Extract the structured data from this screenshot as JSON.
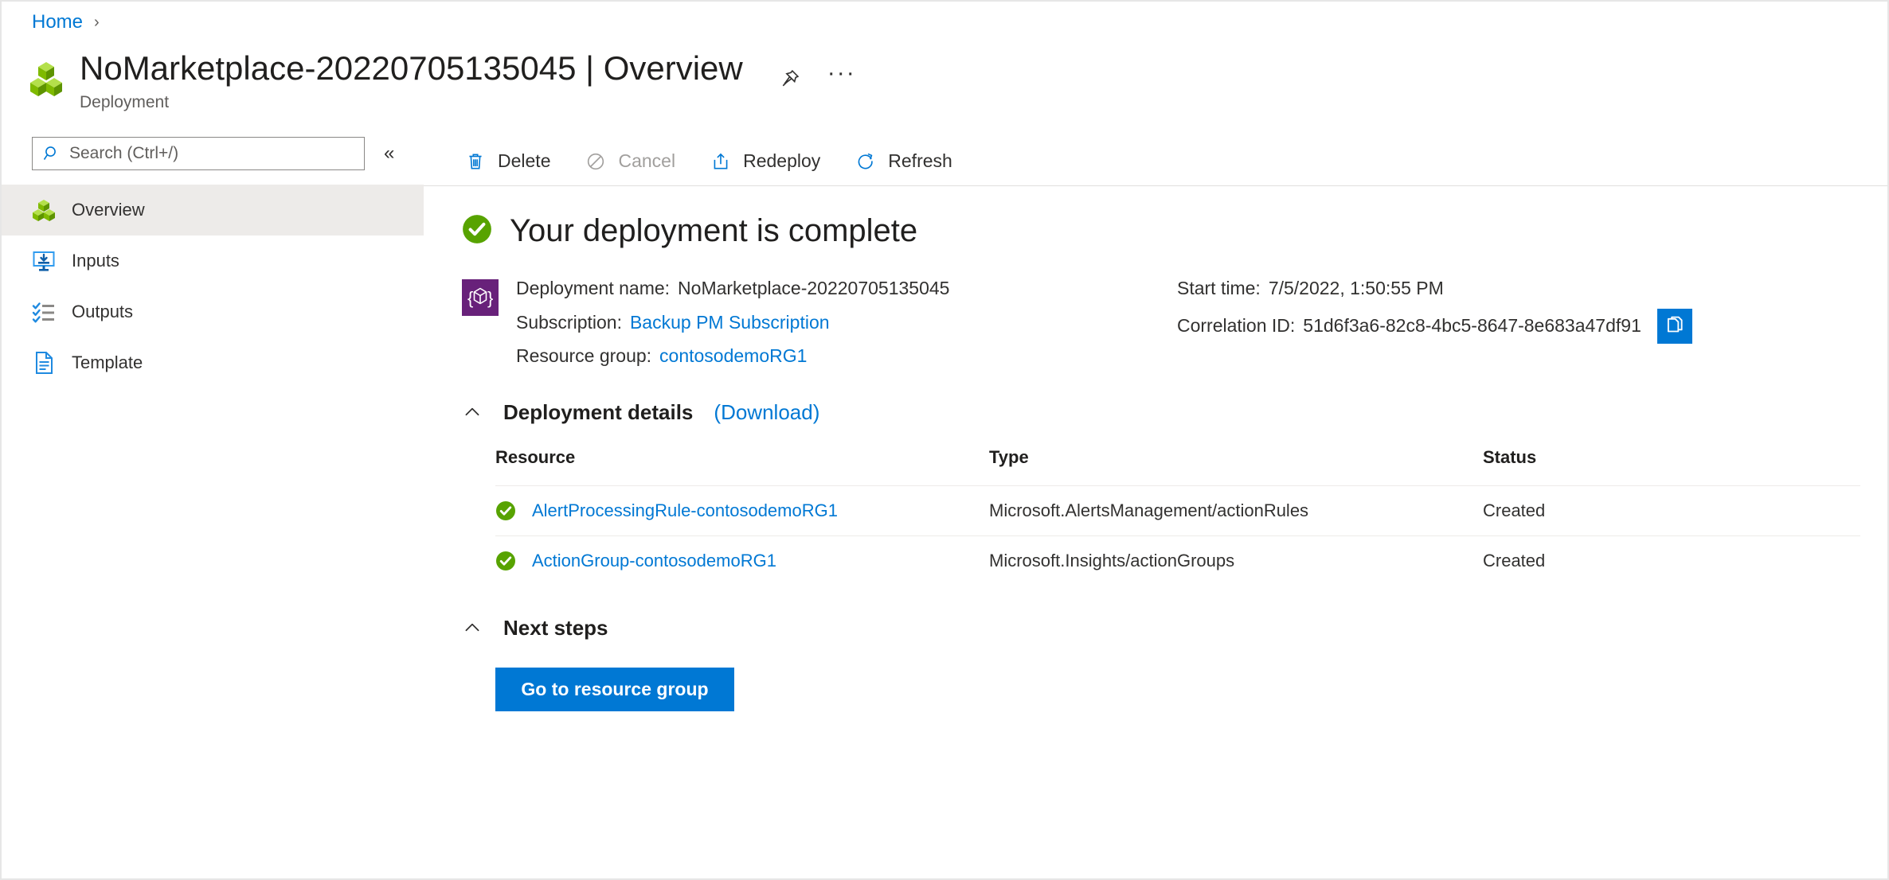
{
  "breadcrumb": {
    "home_label": "Home",
    "separator": "›"
  },
  "header": {
    "title": "NoMarketplace-20220705135045 | Overview",
    "subtitle": "Deployment",
    "icon": "resource-group-cubes-icon",
    "pin_icon": "pin-icon",
    "more_icon": "ellipsis-icon",
    "more_label": "···"
  },
  "sidebar": {
    "search": {
      "placeholder": "Search (Ctrl+/)",
      "value": "",
      "icon": "search-icon"
    },
    "collapse_label": "«",
    "items": [
      {
        "label": "Overview",
        "icon": "cubes-icon",
        "selected": true
      },
      {
        "label": "Inputs",
        "icon": "monitor-download-icon",
        "selected": false
      },
      {
        "label": "Outputs",
        "icon": "checklist-icon",
        "selected": false
      },
      {
        "label": "Template",
        "icon": "document-icon",
        "selected": false
      }
    ]
  },
  "toolbar": {
    "buttons": [
      {
        "label": "Delete",
        "icon": "trash-icon",
        "disabled": false
      },
      {
        "label": "Cancel",
        "icon": "no-entry-icon",
        "disabled": true
      },
      {
        "label": "Redeploy",
        "icon": "upload-box-icon",
        "disabled": false
      },
      {
        "label": "Refresh",
        "icon": "refresh-icon",
        "disabled": false
      }
    ]
  },
  "main": {
    "status_heading": "Your deployment is complete",
    "status_icon": "green-check-circle-icon",
    "deployment_icon": "arm-template-icon",
    "info": {
      "deployment_name_label": "Deployment name:",
      "deployment_name_value": "NoMarketplace-20220705135045",
      "subscription_label": "Subscription:",
      "subscription_value": "Backup PM Subscription",
      "resource_group_label": "Resource group:",
      "resource_group_value": "contosodemoRG1",
      "start_time_label": "Start time:",
      "start_time_value": "7/5/2022, 1:50:55 PM",
      "correlation_id_label": "Correlation ID:",
      "correlation_id_value": "51d6f3a6-82c8-4bc5-8647-8e683a47df91",
      "copy_icon": "copy-to-clipboard-icon"
    },
    "deployment_details": {
      "title": "Deployment details",
      "download_label": "(Download)",
      "chevron_icon": "chevron-up-icon",
      "columns": [
        "Resource",
        "Type",
        "Status"
      ],
      "rows": [
        {
          "status_icon": "green-check-icon",
          "resource": "AlertProcessingRule-contosodemoRG1",
          "type": "Microsoft.AlertsManagement/actionRules",
          "status": "Created"
        },
        {
          "status_icon": "green-check-icon",
          "resource": "ActionGroup-contosodemoRG1",
          "type": "Microsoft.Insights/actionGroups",
          "status": "Created"
        }
      ]
    },
    "next_steps": {
      "title": "Next steps",
      "chevron_icon": "chevron-up-icon",
      "primary_button": "Go to resource group"
    }
  },
  "colors": {
    "accent_blue": "#0078d4",
    "success_green": "#57a300",
    "arm_purple": "#68217a",
    "text_primary": "#323130",
    "text_secondary": "#605e5c",
    "selected_bg": "#edebe9",
    "divider": "#e1dfdd"
  }
}
